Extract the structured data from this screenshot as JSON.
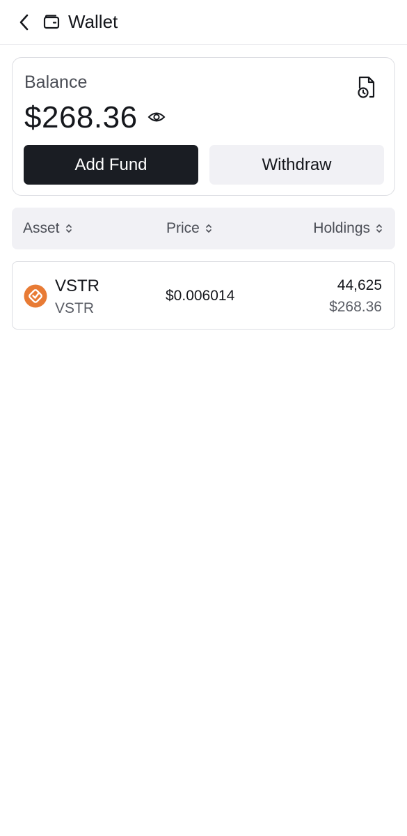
{
  "header": {
    "title": "Wallet",
    "back_icon": "chevron-left-icon",
    "wallet_icon": "wallet-icon"
  },
  "balance": {
    "label": "Balance",
    "amount": "$268.36",
    "visibility_icon": "eye-icon",
    "report_icon": "document-clock-icon",
    "add_fund_label": "Add Fund",
    "withdraw_label": "Withdraw"
  },
  "table": {
    "columns": [
      {
        "label": "Asset"
      },
      {
        "label": "Price"
      },
      {
        "label": "Holdings"
      }
    ],
    "rows": [
      {
        "name": "VSTR",
        "ticker": "VSTR",
        "price": "$0.006014",
        "holdings_amount": "44,625",
        "holdings_value": "$268.36",
        "logo_icon": "vstr-coin-icon"
      }
    ]
  },
  "colors": {
    "primary_button": "#1a1d23",
    "secondary_button": "#f1f1f5",
    "coin_orange": "#e87b35"
  }
}
